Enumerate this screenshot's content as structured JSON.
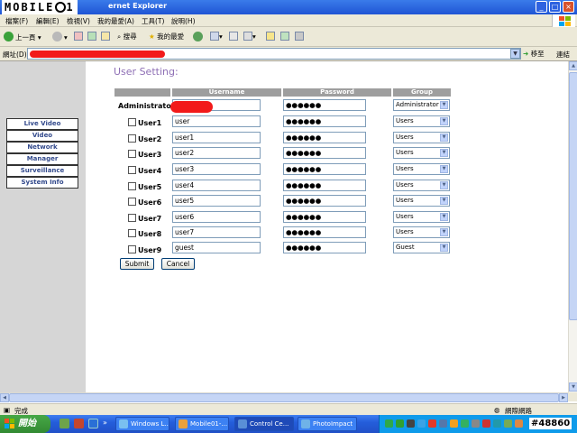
{
  "window": {
    "title": "ernet Explorer",
    "watermark_logo": "MOBILE01"
  },
  "menu": [
    "檔案(F)",
    "編輯(E)",
    "檢視(V)",
    "我的最愛(A)",
    "工具(T)",
    "說明(H)"
  ],
  "toolbar": {
    "back": "上一頁",
    "search": "搜尋",
    "favorites": "我的最愛"
  },
  "address": {
    "label": "網址(D)",
    "go": "移至",
    "links": "連結"
  },
  "sidebar": {
    "items": [
      {
        "label": "Live Video"
      },
      {
        "label": "Video"
      },
      {
        "label": "Network"
      },
      {
        "label": "Manager"
      },
      {
        "label": "Surveillance"
      },
      {
        "label": "System Info"
      }
    ]
  },
  "form": {
    "title": "User Setting:",
    "headers": {
      "username": "Username",
      "password": "Password",
      "group": "Group"
    },
    "admin": {
      "label": "Administrator",
      "username": "",
      "password": "●●●●●●",
      "group": "Administrator"
    },
    "users": [
      {
        "label": "User1",
        "username": "user",
        "password": "●●●●●●",
        "group": "Users"
      },
      {
        "label": "User2",
        "username": "user1",
        "password": "●●●●●●",
        "group": "Users"
      },
      {
        "label": "User3",
        "username": "user2",
        "password": "●●●●●●",
        "group": "Users"
      },
      {
        "label": "User4",
        "username": "user3",
        "password": "●●●●●●",
        "group": "Users"
      },
      {
        "label": "User5",
        "username": "user4",
        "password": "●●●●●●",
        "group": "Users"
      },
      {
        "label": "User6",
        "username": "user5",
        "password": "●●●●●●",
        "group": "Users"
      },
      {
        "label": "User7",
        "username": "user6",
        "password": "●●●●●●",
        "group": "Users"
      },
      {
        "label": "User8",
        "username": "user7",
        "password": "●●●●●●",
        "group": "Users"
      },
      {
        "label": "User9",
        "username": "guest",
        "password": "●●●●●●",
        "group": "Guest"
      }
    ],
    "submit": "Submit",
    "cancel": "Cancel"
  },
  "status": {
    "left": "完成",
    "zone": "網際網路"
  },
  "taskbar": {
    "start": "開始",
    "tasks": [
      {
        "label": "Windows L..."
      },
      {
        "label": "Mobile01-..."
      },
      {
        "label": "Control Ce..."
      },
      {
        "label": "PhotoImpact"
      }
    ],
    "watermark": "#48860"
  },
  "colors": {
    "title_purple": "#8e6fb5",
    "nav_text": "#334a8c",
    "header_gray": "#9e9e9e",
    "redaction": "#f21a1a"
  }
}
